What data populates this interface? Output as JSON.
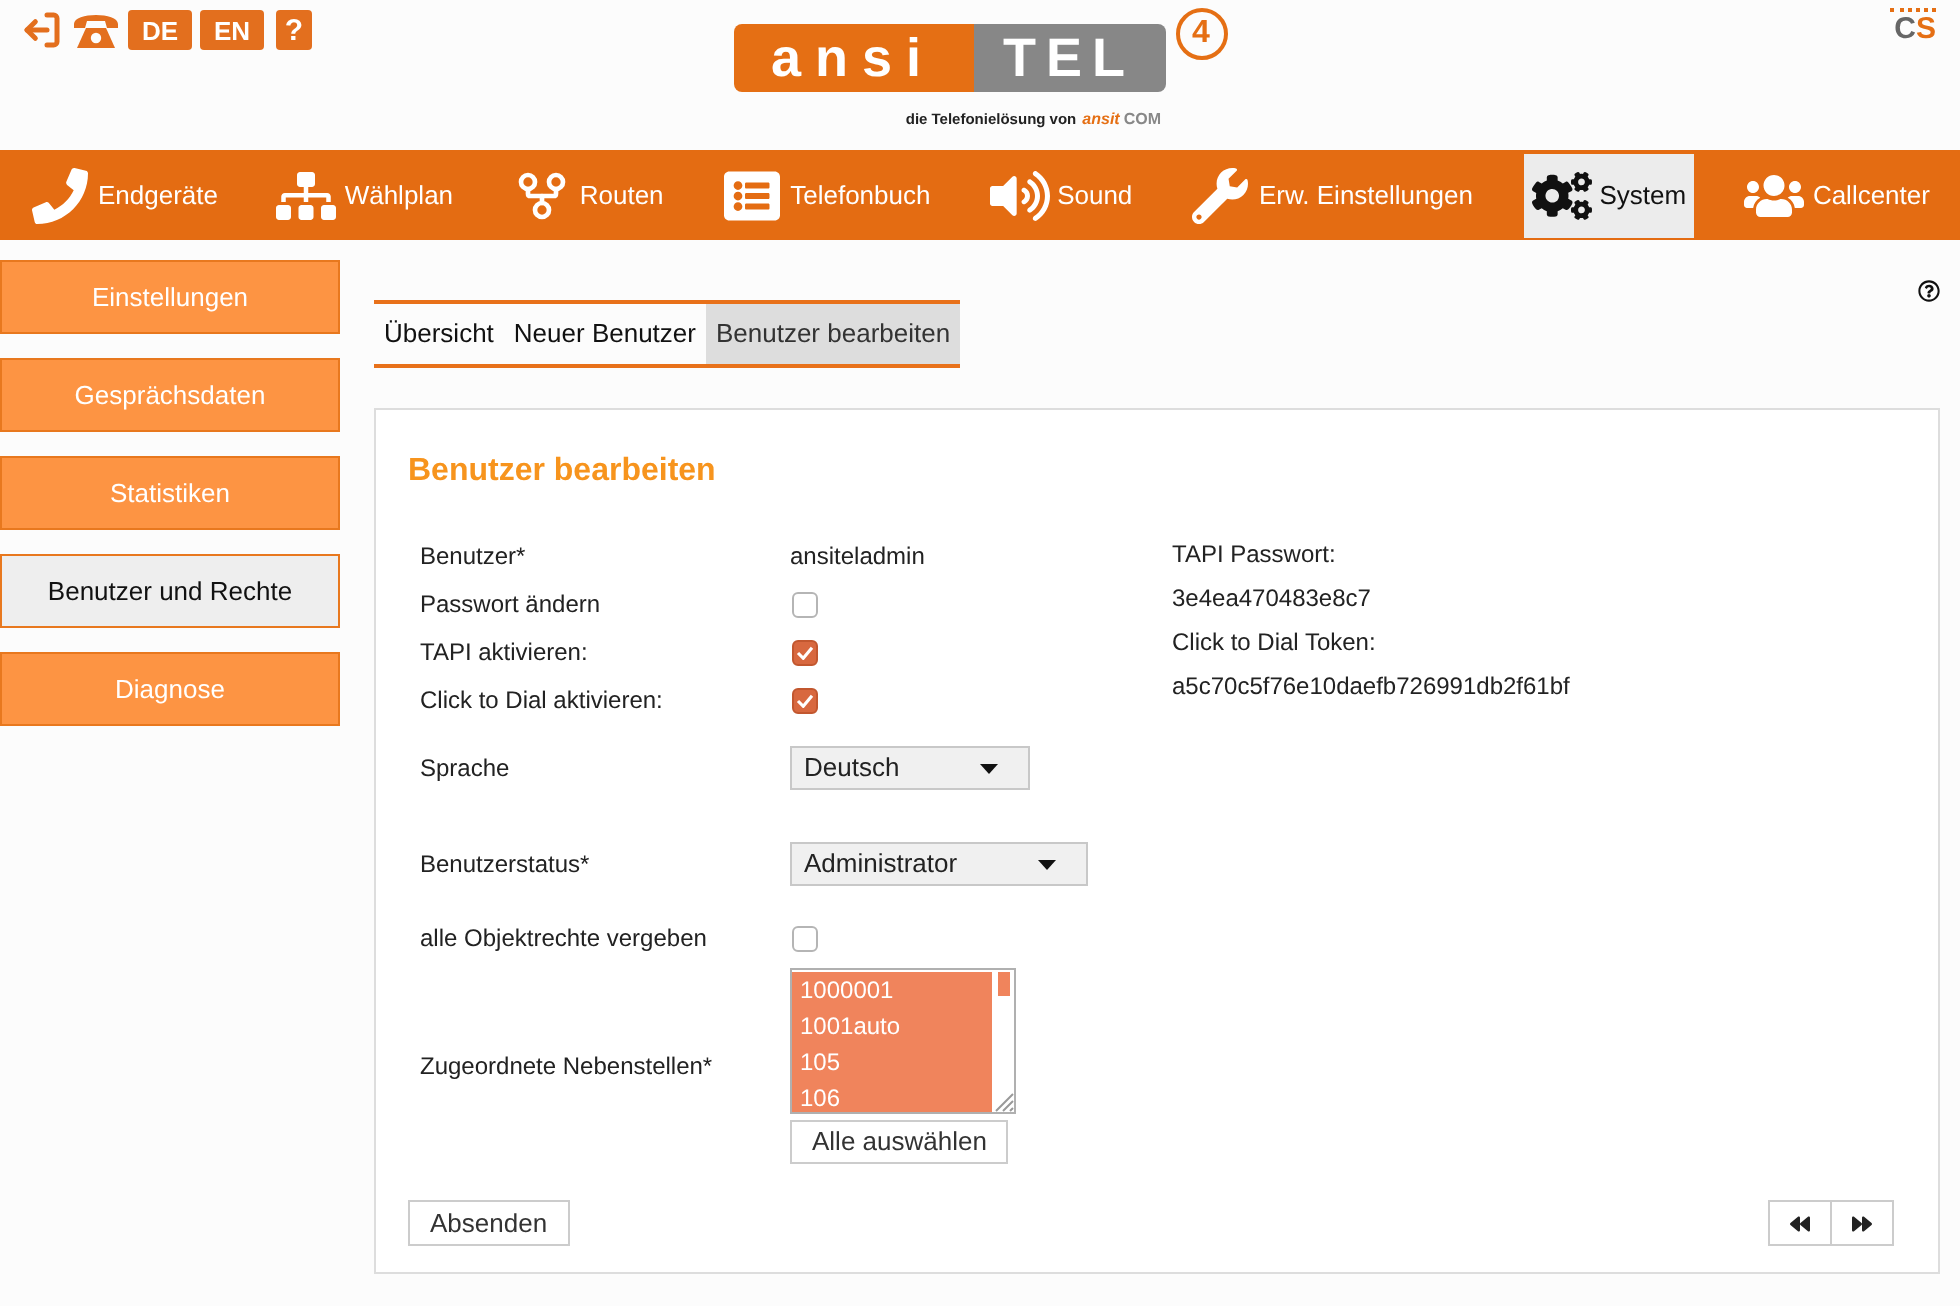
{
  "header": {
    "language_buttons": [
      {
        "label": "DE"
      },
      {
        "label": "EN"
      }
    ],
    "help_button": "?",
    "logo": {
      "left": "ansi",
      "right": "TEL",
      "version": "4",
      "tagline": "die Telefonielösung von",
      "brand": {
        "name": "ansit",
        "suffix": "COM"
      }
    },
    "corner_logo": "CS"
  },
  "nav": [
    {
      "label": "Endgeräte",
      "selected": false
    },
    {
      "label": "Wählplan",
      "selected": false
    },
    {
      "label": "Routen",
      "selected": false
    },
    {
      "label": "Telefonbuch",
      "selected": false
    },
    {
      "label": "Sound",
      "selected": false
    },
    {
      "label": "Erw. Einstellungen",
      "selected": false
    },
    {
      "label": "System",
      "selected": true
    },
    {
      "label": "Callcenter",
      "selected": false
    }
  ],
  "sidebar": [
    {
      "label": "Einstellungen",
      "selected": false
    },
    {
      "label": "Gesprächsdaten",
      "selected": false
    },
    {
      "label": "Statistiken",
      "selected": false
    },
    {
      "label": "Benutzer und Rechte",
      "selected": true
    },
    {
      "label": "Diagnose",
      "selected": false
    }
  ],
  "tabs": [
    {
      "label": "Übersicht",
      "selected": false
    },
    {
      "label": "Neuer Benutzer",
      "selected": false
    },
    {
      "label": "Benutzer bearbeiten",
      "selected": true
    }
  ],
  "form": {
    "title": "Benutzer bearbeiten",
    "fields": [
      {
        "kind": "text",
        "label": "Benutzer*",
        "value": "ansiteladmin"
      },
      {
        "kind": "checkbox",
        "label": "Passwort ändern",
        "checked": false
      },
      {
        "kind": "checkbox",
        "label": "TAPI aktivieren:",
        "checked": true
      },
      {
        "kind": "checkbox",
        "label": "Click to Dial aktivieren:",
        "checked": true
      },
      {
        "kind": "select",
        "label": "Sprache",
        "value": "Deutsch"
      },
      {
        "kind": "select",
        "label": "Benutzerstatus*",
        "value": "Administrator"
      },
      {
        "kind": "checkbox",
        "label": "alle Objektrechte vergeben",
        "checked": false
      },
      {
        "kind": "listbox",
        "label": "Zugeordnete Nebenstellen*",
        "options": [
          {
            "label": "1000001",
            "selected": true
          },
          {
            "label": "1001auto",
            "selected": true
          },
          {
            "label": "105",
            "selected": true
          },
          {
            "label": "106",
            "selected": true
          }
        ],
        "button": "Alle auswählen"
      }
    ],
    "info": [
      {
        "label": "TAPI Passwort:",
        "value": "3e4ea470483e8c7"
      },
      {
        "label": "Click to Dial Token:",
        "value": "a5c70c5f76e10daefb726991db2f61bf"
      }
    ],
    "submit": "Absenden"
  }
}
